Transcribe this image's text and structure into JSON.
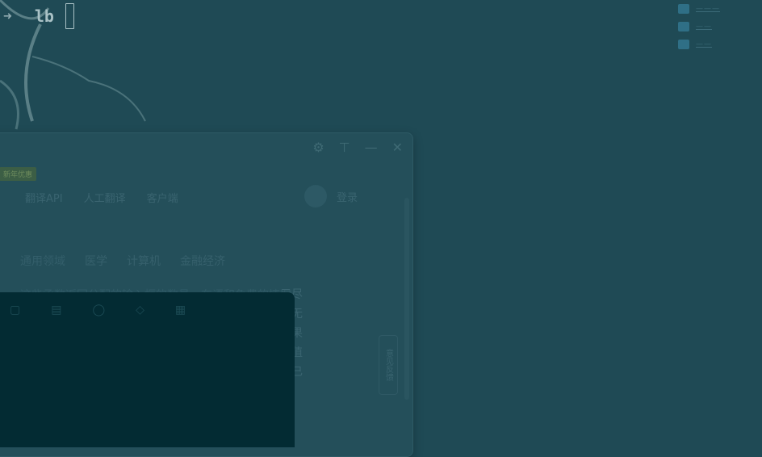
{
  "terminal": {
    "arrow": "➜",
    "word": "lb"
  },
  "desktop": {
    "icons": [
      {
        "label": "———"
      },
      {
        "label": "——"
      },
      {
        "label": "——"
      }
    ]
  },
  "window": {
    "controls": {
      "settings": "⚙",
      "pin": "⊤",
      "minimize": "—",
      "close": "✕"
    },
    "badge": "新年优惠",
    "top_nav": [
      "翻译API",
      "人工翻译",
      "客户端"
    ],
    "login": "登录",
    "domain_tabs": [
      "通用领域",
      "医学",
      "计算机",
      "金融经济"
    ],
    "text_top": "这些函数返回分配的输入框的数量，在语和免费的情况",
    "text_fragments": [
      "示尽",
      "于无",
      "如果",
      "回值",
      "回已"
    ],
    "feedback": "意见反馈"
  }
}
